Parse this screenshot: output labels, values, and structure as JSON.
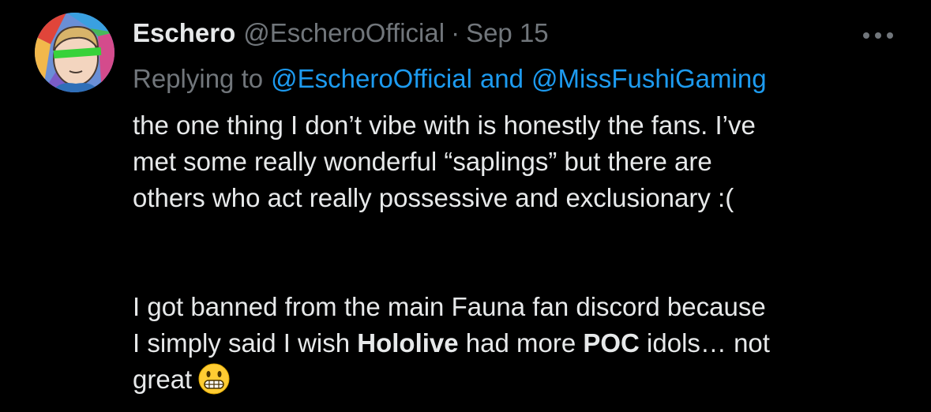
{
  "tweet": {
    "display_name": "Eschero",
    "handle": "@EscheroOfficial",
    "separator": "·",
    "date": "Sep 15",
    "more_icon": "more-horizontal-icon",
    "replying_prefix": "Replying to",
    "reply_mention_1": "@EscheroOfficial",
    "reply_and": "and",
    "reply_mention_2": "@MissFushiGaming",
    "paragraph_1": "the one thing I don’t vibe with is honestly the fans. I’ve\nmet some really wonderful “saplings” but there are\nothers who act really possessive and exclusionary :(",
    "p2_part1": "I got banned from the main Fauna fan discord because\nI simply said I wish ",
    "p2_bold1": "Hololive",
    "p2_part2": " had more ",
    "p2_bold2": "POC",
    "p2_part3": " idols… not\ngreat",
    "emoji": "grimacing-face-emoji"
  },
  "colors": {
    "background": "#000000",
    "text": "#e7e9ea",
    "muted": "#71767b",
    "link": "#1d9bf0"
  }
}
